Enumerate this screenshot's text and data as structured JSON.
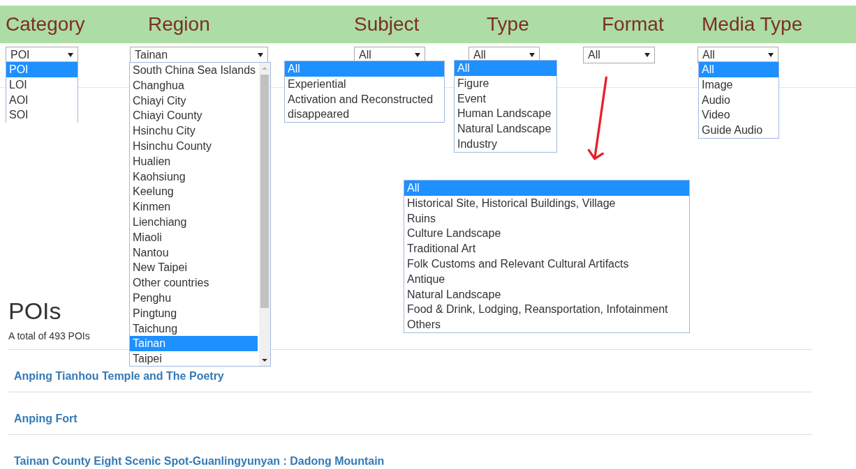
{
  "filters": [
    {
      "label": "Category",
      "value": "POI",
      "kind": "plain",
      "options": [
        {
          "text": "POI",
          "selected": true
        },
        {
          "text": "LOI",
          "selected": false
        },
        {
          "text": "AOI",
          "selected": false
        },
        {
          "text": "SOI",
          "selected": false
        }
      ]
    },
    {
      "label": "Region",
      "value": "Tainan",
      "kind": "scrolling",
      "options": [
        {
          "text": "South China Sea Islands",
          "selected": false
        },
        {
          "text": "Changhua",
          "selected": false
        },
        {
          "text": "Chiayi City",
          "selected": false
        },
        {
          "text": "Chiayi County",
          "selected": false
        },
        {
          "text": "Hsinchu City",
          "selected": false
        },
        {
          "text": "Hsinchu County",
          "selected": false
        },
        {
          "text": "Hualien",
          "selected": false
        },
        {
          "text": "Kaohsiung",
          "selected": false
        },
        {
          "text": "Keelung",
          "selected": false
        },
        {
          "text": "Kinmen",
          "selected": false
        },
        {
          "text": "Lienchiang",
          "selected": false
        },
        {
          "text": "Miaoli",
          "selected": false
        },
        {
          "text": "Nantou",
          "selected": false
        },
        {
          "text": "New Taipei",
          "selected": false
        },
        {
          "text": "Other countries",
          "selected": false
        },
        {
          "text": "Penghu",
          "selected": false
        },
        {
          "text": "Pingtung",
          "selected": false
        },
        {
          "text": "Taichung",
          "selected": false
        },
        {
          "text": "Tainan",
          "selected": true
        },
        {
          "text": "Taipei",
          "selected": false
        }
      ]
    },
    {
      "label": "Subject",
      "value": "All",
      "kind": "plain",
      "options": [
        {
          "text": "All",
          "selected": true
        },
        {
          "text": "Experiential",
          "selected": false
        },
        {
          "text": "Activation and Reconstructed",
          "selected": false
        },
        {
          "text": "disappeared",
          "selected": false
        }
      ]
    },
    {
      "label": "Type",
      "value": "All",
      "kind": "plain",
      "options": [
        {
          "text": "All",
          "selected": true
        },
        {
          "text": "Figure",
          "selected": false
        },
        {
          "text": "Event",
          "selected": false
        },
        {
          "text": "Human Landscape",
          "selected": false
        },
        {
          "text": "Natural Landscape",
          "selected": false
        },
        {
          "text": "Industry",
          "selected": false
        }
      ]
    },
    {
      "label": "Format",
      "value": "All",
      "kind": "plain",
      "options": [
        {
          "text": "All",
          "selected": true
        },
        {
          "text": "Historical Site, Historical Buildings, Village",
          "selected": false
        },
        {
          "text": "Ruins",
          "selected": false
        },
        {
          "text": "Culture Landscape",
          "selected": false
        },
        {
          "text": "Traditional Art",
          "selected": false
        },
        {
          "text": "Folk Customs and Relevant Cultural Artifacts",
          "selected": false
        },
        {
          "text": "Antique",
          "selected": false
        },
        {
          "text": "Natural Landscape",
          "selected": false
        },
        {
          "text": "Food & Drink, Lodging, Reansportation, Infotainment",
          "selected": false
        },
        {
          "text": "Others",
          "selected": false
        }
      ]
    },
    {
      "label": "Media Type",
      "value": "All",
      "kind": "plain",
      "options": [
        {
          "text": "All",
          "selected": true
        },
        {
          "text": "Image",
          "selected": false
        },
        {
          "text": "Audio",
          "selected": false
        },
        {
          "text": "Video",
          "selected": false
        },
        {
          "text": "Guide Audio",
          "selected": false
        }
      ]
    }
  ],
  "results": {
    "title": "POIs",
    "total": "A total of 493 POIs",
    "items": [
      "Anping Tianhou Temple and The Poetry",
      "Anping Fort",
      "Tainan County Eight Scenic Spot-Guanlingyunyan : Dadong Mountain"
    ]
  }
}
